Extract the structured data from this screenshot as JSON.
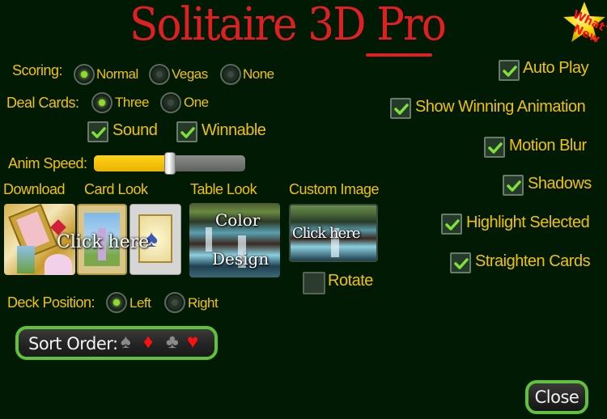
{
  "title": {
    "main": "Solitaire 3D ",
    "accent": "Pro"
  },
  "whats_new": {
    "label": "What's New",
    "icon": "star-icon"
  },
  "scoring": {
    "label": "Scoring:",
    "options": [
      {
        "label": "Normal",
        "selected": true
      },
      {
        "label": "Vegas",
        "selected": false
      },
      {
        "label": "None",
        "selected": false
      }
    ]
  },
  "deal_cards": {
    "label": "Deal Cards:",
    "options": [
      {
        "label": "Three",
        "selected": true
      },
      {
        "label": "One",
        "selected": false
      }
    ]
  },
  "left_checks": [
    {
      "label": "Sound",
      "checked": true
    },
    {
      "label": "Winnable",
      "checked": true
    }
  ],
  "anim_speed": {
    "label": "Anim Speed:",
    "value": 0.5
  },
  "sections": {
    "download": "Download",
    "card_look": "Card Look",
    "table_look": "Table Look",
    "custom_image": "Custom Image"
  },
  "card_look_overlay": "Click here",
  "table_look_overlay": {
    "line1": "Color",
    "line2": "Design"
  },
  "custom_image_overlay": "Click here",
  "rotate": {
    "label": "Rotate",
    "checked": false
  },
  "deck_position": {
    "label": "Deck Position:",
    "options": [
      {
        "label": "Left",
        "selected": true
      },
      {
        "label": "Right",
        "selected": false
      }
    ]
  },
  "sort_order": {
    "label": "Sort Order:",
    "suits": [
      {
        "name": "spade",
        "glyph": "♠",
        "color": "#8a8a8a"
      },
      {
        "name": "diamond",
        "glyph": "♦",
        "color": "#ff1010"
      },
      {
        "name": "club",
        "glyph": "♣",
        "color": "#8a8a8a"
      },
      {
        "name": "heart",
        "glyph": "♥",
        "color": "#ff1010"
      }
    ]
  },
  "right_checks": [
    {
      "label": "Auto Play",
      "checked": true
    },
    {
      "label": "Show Winning Animation",
      "checked": true
    },
    {
      "label": "Motion Blur",
      "checked": true
    },
    {
      "label": "Shadows",
      "checked": true
    },
    {
      "label": "Highlight Selected",
      "checked": true
    },
    {
      "label": "Straighten Cards",
      "checked": true
    }
  ],
  "close_label": "Close",
  "colors": {
    "background": "#001a03",
    "label": "#f2c200",
    "title": "#e02020",
    "accent_green": "#5ec23a",
    "radio_on": "#8fdc2a"
  }
}
